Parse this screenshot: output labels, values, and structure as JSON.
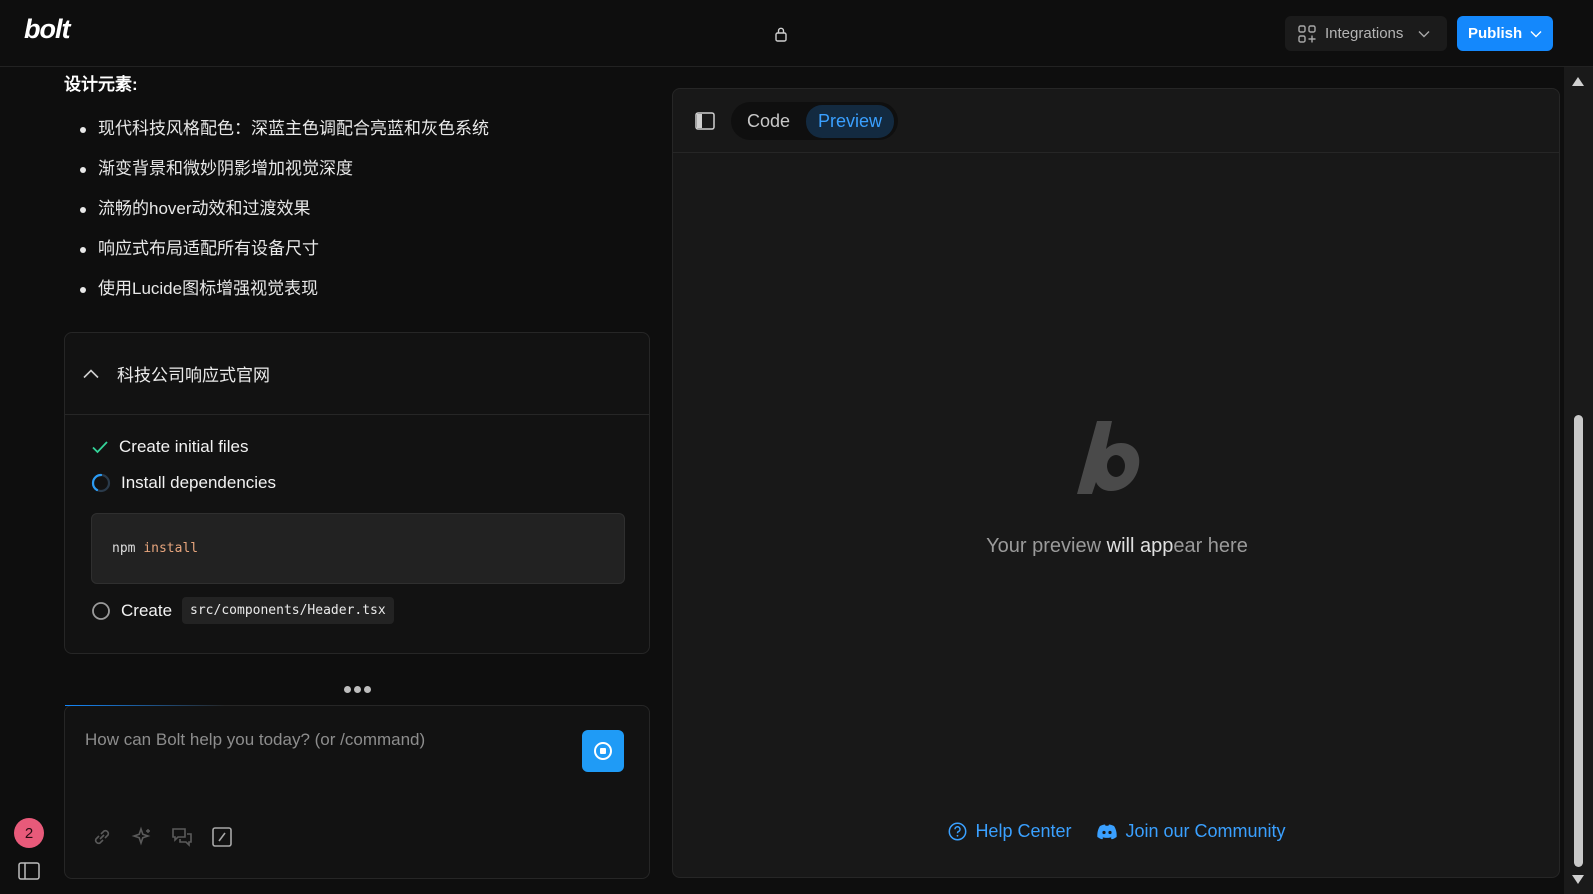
{
  "header": {
    "logo": "bolt",
    "integrations_label": "Integrations",
    "publish_label": "Publish"
  },
  "chat": {
    "design_title": "设计元素:",
    "bullets": [
      "现代科技风格配色：深蓝主色调配合亮蓝和灰色系统",
      "渐变背景和微妙阴影增加视觉深度",
      "流畅的hover动效和过渡效果",
      "响应式布局适配所有设备尺寸",
      "使用Lucide图标增强视觉表现"
    ],
    "artifact": {
      "title": "科技公司响应式官网",
      "steps": [
        {
          "label": "Create initial files",
          "status": "done"
        },
        {
          "label": "Install dependencies",
          "status": "running"
        },
        {
          "label": "Create",
          "status": "pending",
          "code": "src/components/Header.tsx"
        }
      ],
      "command_tool": "npm",
      "command_arg": "install"
    },
    "input_placeholder": "How can Bolt help you today? (or /command)",
    "notification_count": "2"
  },
  "preview": {
    "tabs": [
      "Code",
      "Preview"
    ],
    "active_tab": "Preview",
    "empty_text_1": "Your preview ",
    "empty_text_2": "will app",
    "empty_text_3": "ear here",
    "help_center": "Help Center",
    "community": "Join our Community"
  },
  "colors": {
    "accent": "#1488fc",
    "background": "#0e0e0e",
    "panel": "#181818",
    "badge": "#e85a7a"
  }
}
